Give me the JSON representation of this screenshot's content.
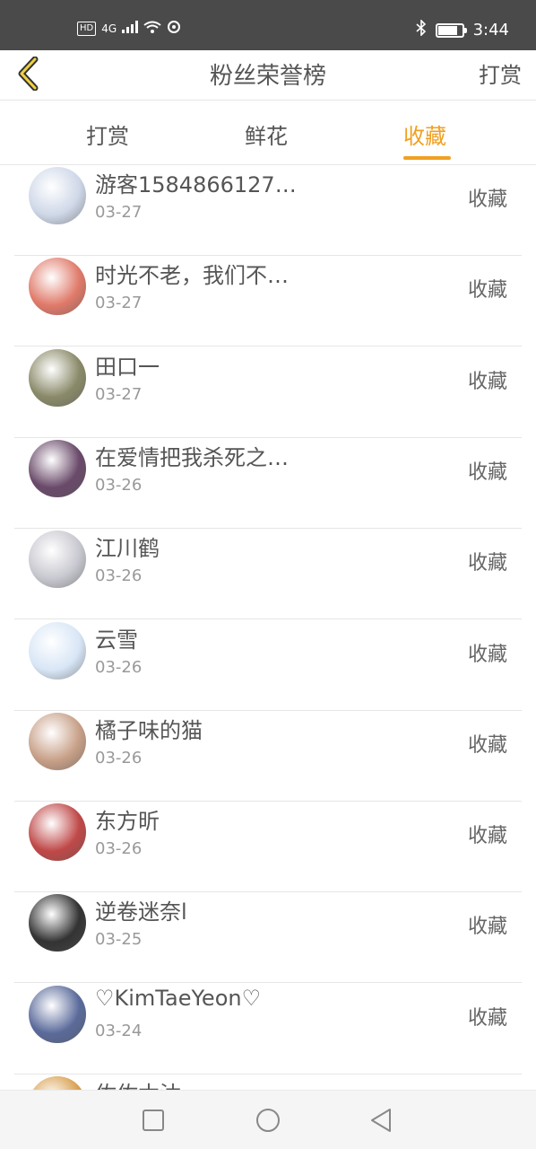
{
  "status": {
    "network": "4G",
    "hd": "HD",
    "time": "3:44",
    "battery_level": 0.85,
    "icons": [
      "hd-icon",
      "signal-icon",
      "wifi-icon",
      "sync-icon",
      "bluetooth-icon",
      "battery-icon"
    ]
  },
  "header": {
    "title": "粉丝荣誉榜",
    "action": "打赏",
    "back_icon": "chevron-left-icon"
  },
  "tabs": [
    {
      "label": "打赏",
      "active": false
    },
    {
      "label": "鲜花",
      "active": false
    },
    {
      "label": "收藏",
      "active": true
    }
  ],
  "list": [
    {
      "name": "游客1584866127…",
      "date": "03-27",
      "action": "收藏",
      "avatar_color": "#cfd8e8"
    },
    {
      "name": "时光不老，我们不…",
      "date": "03-27",
      "action": "收藏",
      "avatar_color": "#e07a6a"
    },
    {
      "name": "田口一",
      "date": "03-27",
      "action": "收藏",
      "avatar_color": "#8a8a6a"
    },
    {
      "name": "在爱情把我杀死之…",
      "date": "03-26",
      "action": "收藏",
      "avatar_color": "#6a4a6a"
    },
    {
      "name": "江川鹤",
      "date": "03-26",
      "action": "收藏",
      "avatar_color": "#c8c8d0"
    },
    {
      "name": "云雪",
      "date": "03-26",
      "action": "收藏",
      "avatar_color": "#d8e6f6"
    },
    {
      "name": "橘子味的猫",
      "date": "03-26",
      "action": "收藏",
      "avatar_color": "#c8a088"
    },
    {
      "name": "东方昕",
      "date": "03-26",
      "action": "收藏",
      "avatar_color": "#c04848"
    },
    {
      "name": "逆卷迷奈l",
      "date": "03-25",
      "action": "收藏",
      "avatar_color": "#333333"
    },
    {
      "name": "♡KimTaeYeon♡",
      "date": "03-24",
      "action": "收藏",
      "avatar_color": "#5a6a9a"
    },
    {
      "name": "佐佐木沐",
      "date": "",
      "action": "",
      "avatar_color": "#d8a050"
    }
  ],
  "colors": {
    "accent": "#f0a020",
    "status_bar": "#4a4a4a"
  },
  "nav": {
    "icons": [
      "square-recent-icon",
      "circle-home-icon",
      "triangle-back-icon"
    ]
  }
}
